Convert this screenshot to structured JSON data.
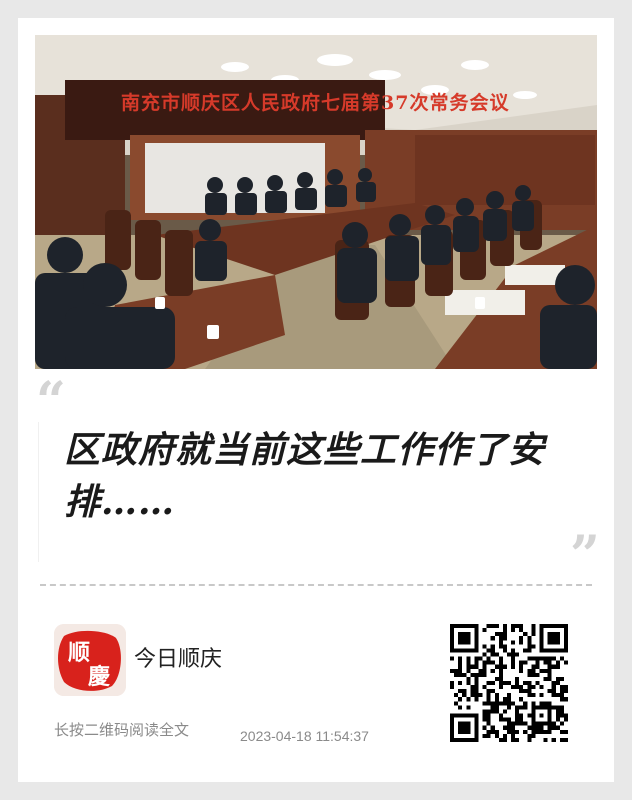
{
  "photo": {
    "banner_text": "南充市顺庆区人民政府七届第37次常务会议",
    "alt_subject": "meeting-room-photo"
  },
  "quote": {
    "open_mark": "“",
    "close_mark": "”",
    "headline": "区政府就当前这些工作作了安排……"
  },
  "footer": {
    "logo_chars": [
      "顺",
      "慶"
    ],
    "account_name": "今日顺庆",
    "hint": "长按二维码阅读全文",
    "timestamp": "2023-04-18 11:54:37",
    "qr_icon": "qr-code-icon"
  },
  "colors": {
    "background": "#e8e8e8",
    "card": "#ffffff",
    "logo_red": "#d8221c",
    "banner_red": "#d63a2a",
    "muted_text": "#8a8a8a"
  }
}
